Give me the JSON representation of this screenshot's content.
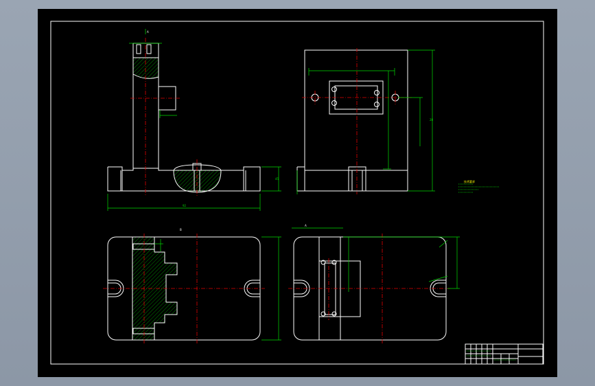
{
  "colors": {
    "frame_bg": "#8c97a6",
    "paper": "#000000",
    "outline": "#ffffff",
    "dimension": "#00dd00",
    "centerline": "#e00000",
    "notes": "#ffff00"
  },
  "icons": [
    "hatch-pattern",
    "u-slot",
    "bolt-hole"
  ],
  "labels": {
    "view_top": "A",
    "view_top_b": "A",
    "view_bottom": "A",
    "section": "B",
    "tech_title": "技术要求",
    "dim_overall": "92",
    "dim_height": "45",
    "dim_side": "28"
  }
}
